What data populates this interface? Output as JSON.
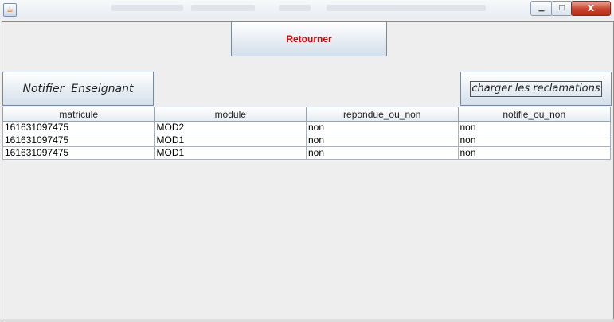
{
  "window": {
    "controls": {
      "minimize": "▁",
      "maximize": "□",
      "close": "X"
    }
  },
  "buttons": {
    "retourner": "Retourner",
    "notifier": "Notifier  Enseignant",
    "charger": "charger les reclamations"
  },
  "table": {
    "headers": [
      "matricule",
      "module",
      "repondue_ou_non",
      "notifie_ou_non"
    ],
    "rows": [
      [
        "161631097475",
        "MOD2",
        "non",
        "non"
      ],
      [
        "161631097475",
        "MOD1",
        "non",
        "non"
      ],
      [
        "161631097475",
        "MOD1",
        "non",
        "non"
      ]
    ]
  },
  "colors": {
    "retourner_text": "#e00000"
  }
}
